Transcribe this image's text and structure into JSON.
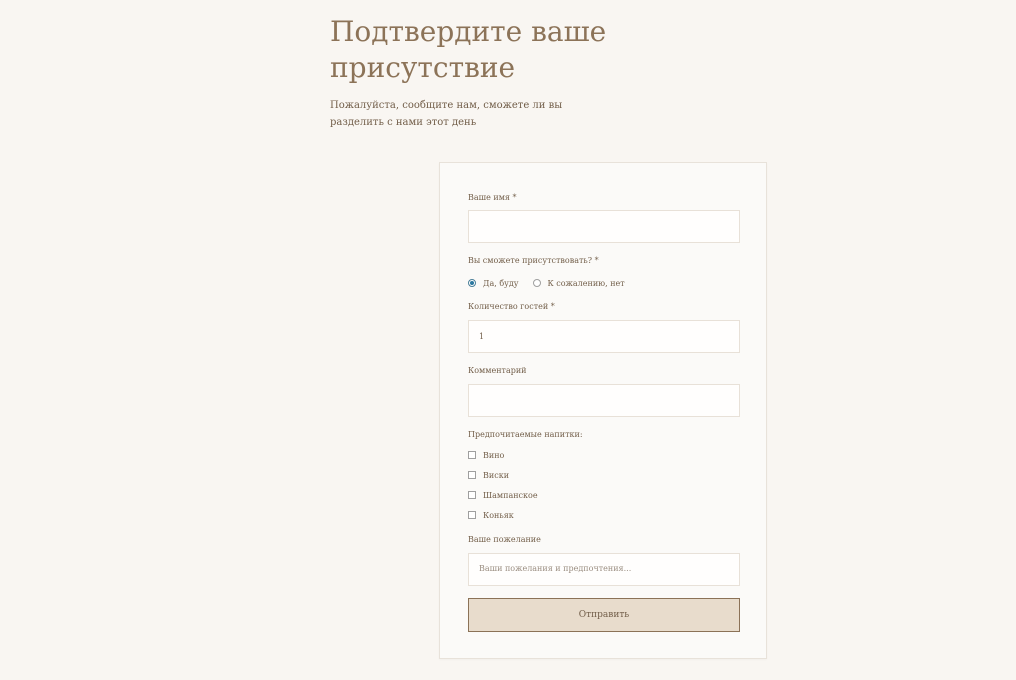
{
  "header": {
    "title": "Подтвердите ваше присутствие",
    "subtitle": "Пожалуйста, сообщите нам, сможете ли вы разделить с нами этот день"
  },
  "form": {
    "name": {
      "label": "Ваше имя *",
      "value": ""
    },
    "attendance": {
      "label": "Вы сможете присутствовать? *",
      "options": [
        {
          "label": "Да, буду",
          "checked": true
        },
        {
          "label": "К сожалению, нет",
          "checked": false
        }
      ]
    },
    "guests": {
      "label": "Количество гостей *",
      "value": "1"
    },
    "comment": {
      "label": "Комментарий",
      "value": ""
    },
    "drinks": {
      "label": "Предпочитаемые напитки:",
      "options": [
        {
          "label": "Вино"
        },
        {
          "label": "Виски"
        },
        {
          "label": "Шампанское"
        },
        {
          "label": "Коньяк"
        }
      ]
    },
    "wish": {
      "label": "Ваше пожелание",
      "placeholder": "Ваши пожелания и предпочтения..."
    },
    "submit_label": "Отправить"
  },
  "colors": {
    "background": "#f9f6f2",
    "title": "#8c7358",
    "text": "#725e49",
    "button": "#e8dccc",
    "radio_checked": "#2b78a0"
  }
}
